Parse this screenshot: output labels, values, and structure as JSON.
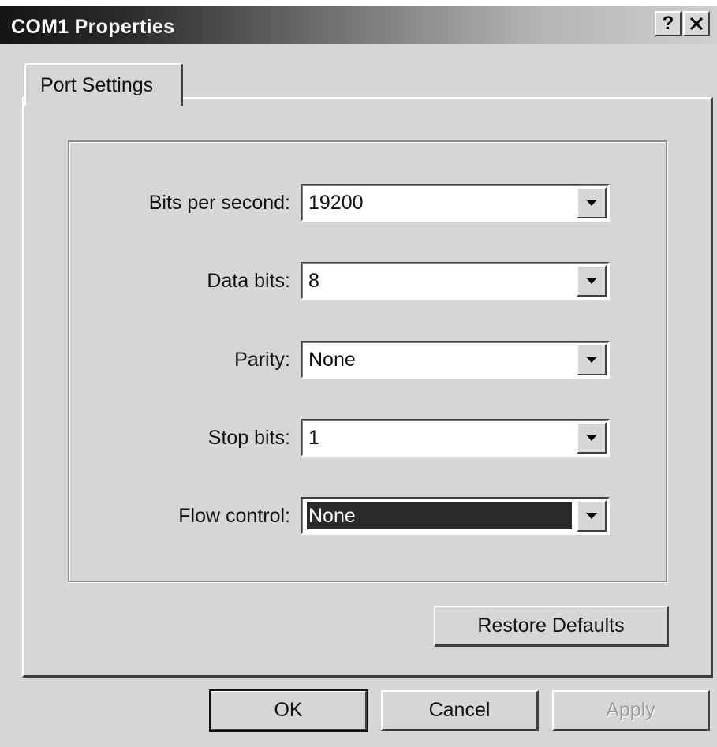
{
  "window": {
    "title": "COM1 Properties",
    "help_label": "?",
    "close_icon": "close-icon"
  },
  "tabs": [
    {
      "label": "Port Settings",
      "active": true
    }
  ],
  "port_settings": {
    "bits_per_second": {
      "label": "Bits per second:",
      "value": "19200"
    },
    "data_bits": {
      "label": "Data bits:",
      "value": "8"
    },
    "parity": {
      "label": "Parity:",
      "value": "None"
    },
    "stop_bits": {
      "label": "Stop bits:",
      "value": "1"
    },
    "flow_control": {
      "label": "Flow control:",
      "value": "None",
      "focused": true
    }
  },
  "buttons": {
    "restore_defaults": "Restore Defaults",
    "ok": "OK",
    "cancel": "Cancel",
    "apply": "Apply"
  },
  "colors": {
    "selection_background": "#2a2a2a",
    "dialog_face": "#d6d6d6"
  }
}
